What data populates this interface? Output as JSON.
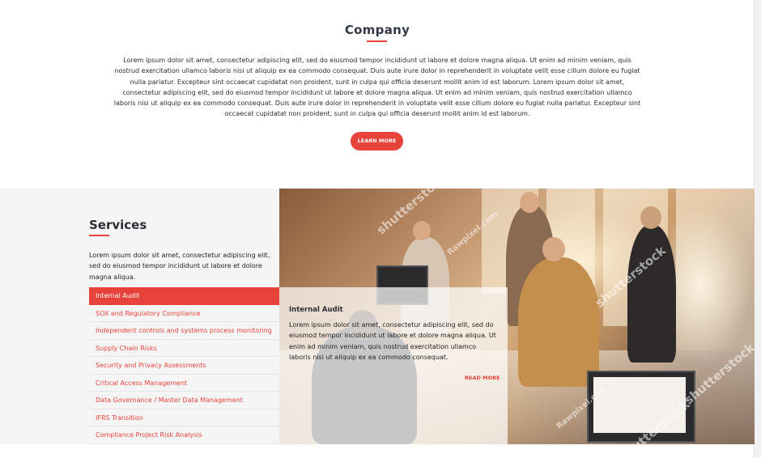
{
  "company": {
    "title": "Company",
    "body": "Lorem ipsum dolor sit amet, consectetur adipiscing elit, sed do eiusmod tempor incididunt ut labore et dolore magna aliqua. Ut enim ad minim veniam, quis nostrud exercitation ullamco laboris nisi ut aliquip ex ea commodo consequat. Duis aute irure dolor in reprehenderit in voluptate velit esse cillum dolore eu fugiat nulla pariatur. Excepteur sint occaecat cupidatat non proident, sunt in culpa qui officia deserunt mollit anim id est laborum. Lorem ipsum dolor sit amet, consectetur adipiscing elit, sed do eiusmod tempor incididunt ut labore et dolore magna aliqua. Ut enim ad minim veniam, quis nostrud exercitation ullamco laboris nisi ut aliquip ex ea commodo consequat. Duis aute irure dolor in reprehenderit in voluptate velit esse cillum dolore eu fugiat nulla pariatur. Excepteur sint occaecat cupidatat non proident, sunt in culpa qui officia deserunt mollit anim id est laborum.",
    "button_label": "LEARN MORE"
  },
  "services": {
    "title": "Services",
    "intro": "Lorem ipsum dolor sit amet, consectetur adipiscing elit, sed do eiusmod tempor incididunt ut labore et dolore magna aliqua.",
    "items": [
      {
        "label": "Internal Audit",
        "active": true
      },
      {
        "label": "SOX and Regulatory Compliance",
        "active": false
      },
      {
        "label": "Independent controls and systems process monitoring",
        "active": false
      },
      {
        "label": "Supply Chain Risks",
        "active": false
      },
      {
        "label": "Security and Privacy Assessments",
        "active": false
      },
      {
        "label": "Critical Access Management",
        "active": false
      },
      {
        "label": "Data Governance / Master Data Management",
        "active": false
      },
      {
        "label": "IFRS Transition",
        "active": false
      },
      {
        "label": "Compliance Project Risk Analysis",
        "active": false
      }
    ],
    "detail": {
      "title": "Internal Audit",
      "body": "Lorem ipsum dolor sit amet, consectetur adipiscing elit, sed do eiusmod tempor incididunt ut labore et dolore magna aliqua. Ut enim ad minim veniam, quis nostrud exercitation ullamco laboris nisi ut aliquip ex ea commodo consequat.",
      "read_more_label": "READ MORE"
    },
    "watermarks": [
      "shutterstock",
      "Rawpixel.com",
      "shutterstock",
      "shutterstock",
      "shutterstock",
      "Rawpixel.com"
    ]
  },
  "colors": {
    "accent": "#e8433a",
    "heading": "#2a2f36",
    "section_bg": "#f5f5f5"
  }
}
